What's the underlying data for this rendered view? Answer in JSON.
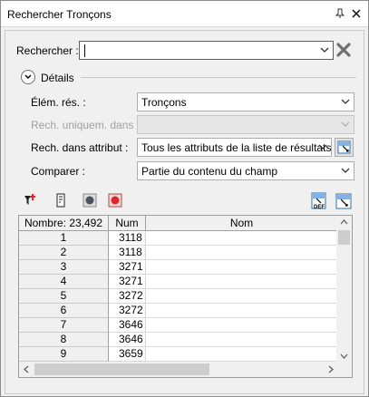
{
  "window": {
    "title": "Rechercher Tronçons"
  },
  "search": {
    "label": "Rechercher :",
    "value": ""
  },
  "details": {
    "label": "Détails"
  },
  "fields": {
    "elem_res_label": "Élém. rés. :",
    "elem_res_value": "Tronçons",
    "rech_uniquem_label": "Rech. uniquem. dans :",
    "rech_uniquem_value": "",
    "rech_attr_label": "Rech. dans attribut :",
    "rech_attr_value": "Tous les attributs de la liste de résultats",
    "comparer_label": "Comparer :",
    "comparer_value": "Partie du contenu du champ"
  },
  "toolbar": {
    "left_icons": [
      "filter-add-icon",
      "list-export-icon",
      "record-gray-icon",
      "record-red-icon"
    ],
    "right_icons": [
      "def-icon",
      "select-icon"
    ],
    "def_text": "DEF"
  },
  "grid": {
    "count_header": "Nombre: 23,492",
    "columns": [
      "Num",
      "Nom"
    ],
    "rows": [
      {
        "n": "1",
        "num": "3118",
        "nom": ""
      },
      {
        "n": "2",
        "num": "3118",
        "nom": ""
      },
      {
        "n": "3",
        "num": "3271",
        "nom": ""
      },
      {
        "n": "4",
        "num": "3271",
        "nom": ""
      },
      {
        "n": "5",
        "num": "3272",
        "nom": ""
      },
      {
        "n": "6",
        "num": "3272",
        "nom": ""
      },
      {
        "n": "7",
        "num": "3646",
        "nom": ""
      },
      {
        "n": "8",
        "num": "3646",
        "nom": ""
      },
      {
        "n": "9",
        "num": "3659",
        "nom": ""
      }
    ]
  },
  "colors": {
    "accent": "#0078d7",
    "red": "#e0242c"
  }
}
